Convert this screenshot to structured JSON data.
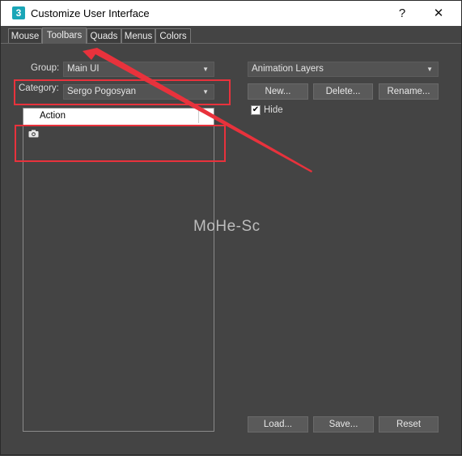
{
  "window": {
    "title": "Customize User Interface",
    "app_icon_text": "3",
    "help_glyph": "?",
    "close_glyph": "✕"
  },
  "tabs": [
    {
      "label": "Mouse",
      "active": false
    },
    {
      "label": "Toolbars",
      "active": true
    },
    {
      "label": "Quads",
      "active": false
    },
    {
      "label": "Menus",
      "active": false
    },
    {
      "label": "Colors",
      "active": false
    }
  ],
  "left": {
    "group_label": "Group:",
    "group_value": "Main UI",
    "category_label": "Category:",
    "category_value": "Sergo Pogosyan",
    "list_header": "Action",
    "list_items": [
      {
        "icon": "camera-icon"
      }
    ]
  },
  "right": {
    "toolbar_select": "Animation Layers",
    "new_button": "New...",
    "delete_button": "Delete...",
    "rename_button": "Rename...",
    "hide_label": "Hide",
    "hide_checked": true,
    "load_button": "Load...",
    "save_button": "Save...",
    "reset_button": "Reset"
  },
  "watermark": "MoHe-Sc",
  "colors": {
    "annotation": "#e8323c",
    "panel_bg": "#444444",
    "app_icon": "#1aa6b7"
  }
}
